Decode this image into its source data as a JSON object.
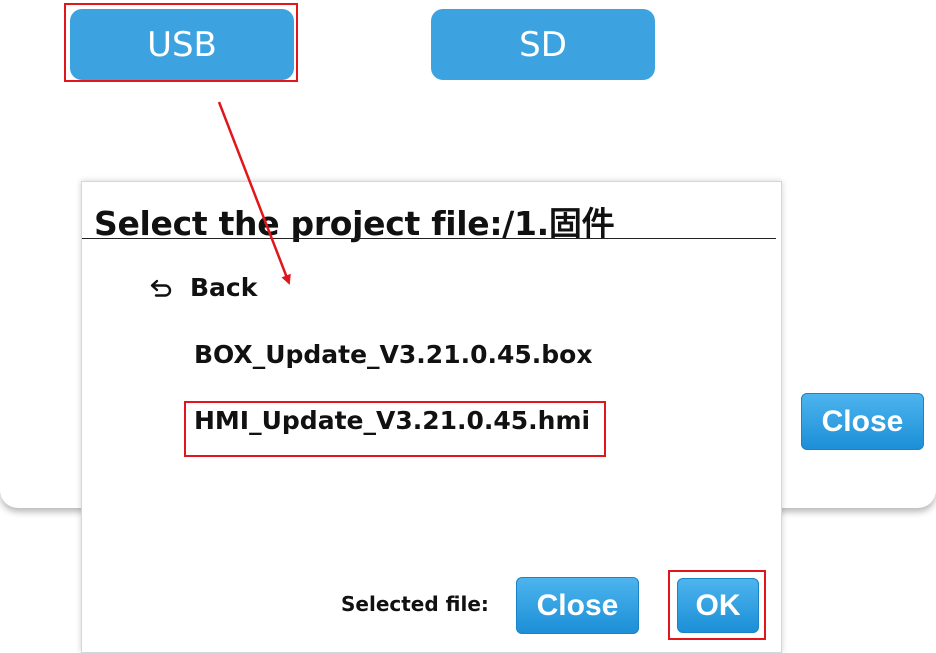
{
  "source_buttons": {
    "usb_label": "USB",
    "sd_label": "SD"
  },
  "background": {
    "close_label": "Close"
  },
  "dialog": {
    "title": "Select the project file:/1.固件",
    "back_label": "Back",
    "files": [
      {
        "name": "BOX_Update_V3.21.0.45.box"
      },
      {
        "name": "HMI_Update_V3.21.0.45.hmi"
      }
    ],
    "selected_file_label": "Selected file:",
    "close_label": "Close",
    "ok_label": "OK"
  },
  "colors": {
    "accent_blue": "#3ca3e0",
    "highlight_red": "#e1161c"
  },
  "icons": {
    "back": "back-arrow-icon"
  }
}
